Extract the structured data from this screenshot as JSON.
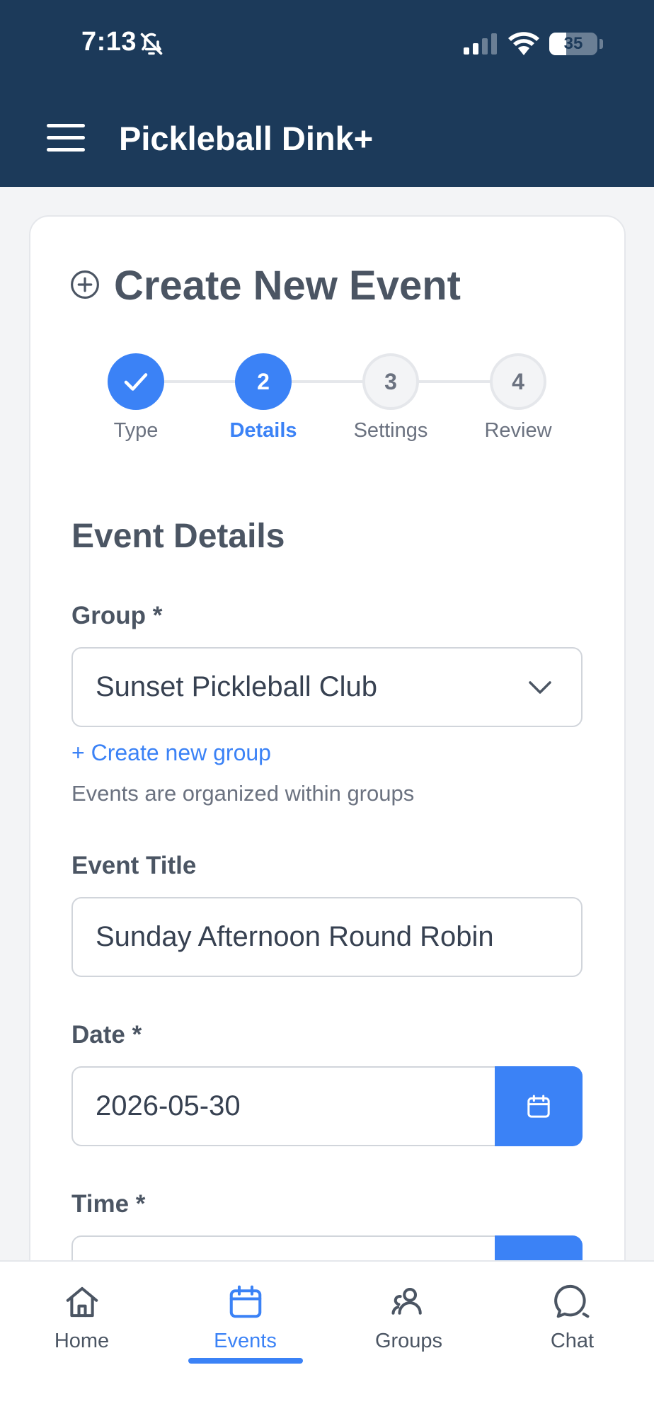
{
  "status_bar": {
    "time": "7:13",
    "battery": "35",
    "battery_level": 0.35
  },
  "header": {
    "title": "Pickleball Dink+"
  },
  "card": {
    "title": "Create New Event"
  },
  "stepper": {
    "steps": [
      {
        "number": "1",
        "label": "Type",
        "state": "done"
      },
      {
        "number": "2",
        "label": "Details",
        "state": "active"
      },
      {
        "number": "3",
        "label": "Settings",
        "state": "todo"
      },
      {
        "number": "4",
        "label": "Review",
        "state": "todo"
      }
    ]
  },
  "form": {
    "section_title": "Event Details",
    "group_label": "Group *",
    "group_value": "Sunset Pickleball Club",
    "create_group_link": "+ Create new group",
    "group_helper": "Events are organized within groups",
    "title_label": "Event Title",
    "title_value": "Sunday Afternoon Round Robin",
    "date_label": "Date *",
    "date_value": "2026-05-30",
    "time_label": "Time *"
  },
  "bottom_nav": {
    "items": [
      {
        "label": "Home",
        "icon": "home-icon"
      },
      {
        "label": "Events",
        "icon": "calendar-icon",
        "active": true
      },
      {
        "label": "Groups",
        "icon": "users-icon"
      },
      {
        "label": "Chat",
        "icon": "chat-icon"
      }
    ]
  },
  "colors": {
    "header": "#1c3a5a",
    "accent": "#3b82f6",
    "text": "#4b5563"
  }
}
